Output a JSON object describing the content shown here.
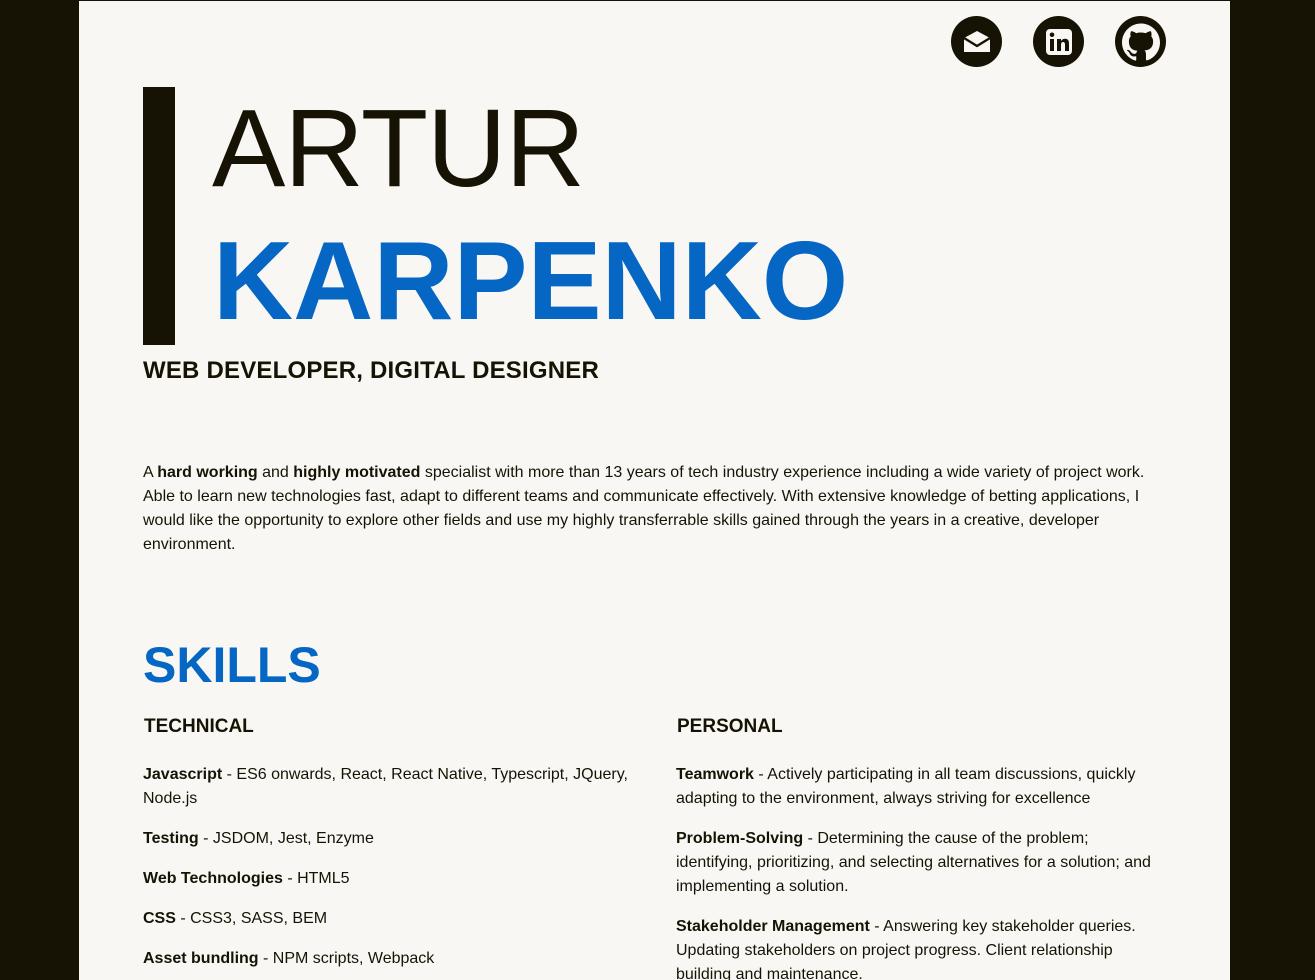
{
  "social": {
    "email_label": "Email",
    "linkedin_label": "LinkedIn",
    "github_label": "GitHub"
  },
  "header": {
    "first_name": "ARTUR",
    "last_name": "KARPENKO",
    "job_title": "WEB DEVELOPER, DIGITAL DESIGNER"
  },
  "summary": {
    "p1": "A ",
    "b1": "hard working",
    "p2": " and ",
    "b2": "highly motivated",
    "p3": " specialist with more than 13 years of tech industry experience including a wide variety of project work. Able to learn new technologies fast, adapt to different teams and communicate effectively. With extensive knowledge of betting applications, I would like the opportunity to explore other fields and use my highly transferrable skills gained through the years in a creative, developer environment."
  },
  "skills": {
    "heading": "SKILLS",
    "technical": {
      "heading": "TECHNICAL",
      "items": [
        {
          "name": "Javascript",
          "desc": " - ES6 onwards, React, React Native, Typescript, JQuery, Node.js"
        },
        {
          "name": "Testing",
          "desc": " - JSDOM, Jest, Enzyme"
        },
        {
          "name": "Web Technologies",
          "desc": " - HTML5"
        },
        {
          "name": "CSS",
          "desc": " - CSS3, SASS, BEM"
        },
        {
          "name": "Asset bundling",
          "desc": " - NPM scripts, Webpack"
        }
      ]
    },
    "personal": {
      "heading": "PERSONAL",
      "items": [
        {
          "name": "Teamwork",
          "desc": " - Actively participating in all team discussions, quickly adapting to the environment, always striving for excellence"
        },
        {
          "name": "Problem-Solving",
          "desc": " - Determining the cause of the problem; identifying, prioritizing, and selecting alternatives for a solution; and implementing a solution."
        },
        {
          "name": "Stakeholder Management",
          "desc": " - Answering key stakeholder queries. Updating stakeholders on project progress. Client relationship building and maintenance."
        }
      ]
    }
  },
  "colors": {
    "dark": "#171304",
    "accent": "#0566c4",
    "page_bg": "#f8f7f4"
  }
}
